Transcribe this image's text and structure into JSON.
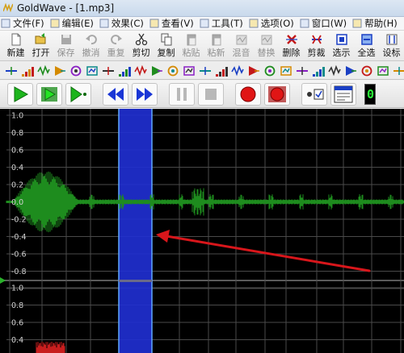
{
  "window": {
    "title": "GoldWave - [1.mp3]"
  },
  "menu": {
    "items": [
      {
        "label": "文件(F)",
        "icon": "file-doc-icon"
      },
      {
        "label": "编辑(E)",
        "icon": "edit-pencil-icon"
      },
      {
        "label": "效果(C)",
        "icon": "effects-icon"
      },
      {
        "label": "查看(V)",
        "icon": "view-icon"
      },
      {
        "label": "工具(T)",
        "icon": "tools-icon"
      },
      {
        "label": "选项(O)",
        "icon": "options-icon"
      },
      {
        "label": "窗口(W)",
        "icon": "window-icon"
      },
      {
        "label": "帮助(H)",
        "icon": "help-icon"
      }
    ]
  },
  "toolbar": {
    "buttons": [
      {
        "label": "新建",
        "icon": "new-file-icon",
        "enabled": true
      },
      {
        "label": "打开",
        "icon": "open-folder-icon",
        "enabled": true
      },
      {
        "label": "保存",
        "icon": "save-disk-icon",
        "enabled": false
      },
      {
        "label": "撤消",
        "icon": "undo-arrow-icon",
        "enabled": false
      },
      {
        "label": "重复",
        "icon": "redo-arrow-icon",
        "enabled": false
      },
      {
        "label": "剪切",
        "icon": "scissors-icon",
        "enabled": true
      },
      {
        "label": "复制",
        "icon": "copy-icon",
        "enabled": true
      },
      {
        "label": "粘贴",
        "icon": "paste-icon",
        "enabled": false
      },
      {
        "label": "粘新",
        "icon": "paste-new-icon",
        "enabled": false
      },
      {
        "label": "混音",
        "icon": "mix-icon",
        "enabled": false
      },
      {
        "label": "替换",
        "icon": "replace-icon",
        "enabled": false
      },
      {
        "label": "删除",
        "icon": "delete-icon",
        "enabled": true
      },
      {
        "label": "剪裁",
        "icon": "trim-icon",
        "enabled": true
      },
      {
        "label": "选示",
        "icon": "select-view-icon",
        "enabled": true
      },
      {
        "label": "全选",
        "icon": "select-all-icon",
        "enabled": true
      },
      {
        "label": "设标",
        "icon": "set-marker-icon",
        "enabled": true
      }
    ]
  },
  "effects_toolbar": {
    "icons": [
      "dc-offset-icon",
      "equalizer-icon",
      "doppler-icon",
      "echo-icon",
      "fade-in-icon",
      "fade-out-icon",
      "pan-icon",
      "invert-icon",
      "volume-icon",
      "pitch-icon",
      "noise-icon",
      "filter-icon",
      "spectrum-icon",
      "compressor-icon",
      "mechanize-icon",
      "reverse-icon",
      "offset-icon",
      "flanger-icon",
      "resample-icon",
      "shape-icon",
      "channel-icon",
      "matrix-icon",
      "grid-icon",
      "playback-rate-icon",
      "time-warp-icon",
      "noise-reduction-icon",
      "pop-click-icon",
      "lowpass-icon",
      "highpass-icon",
      "bandpass-icon",
      "bass-icon",
      "treble-icon"
    ]
  },
  "transport": {
    "buttons": [
      {
        "name": "play-button",
        "icon": "play-icon"
      },
      {
        "name": "play-selection-button",
        "icon": "play-selection-icon"
      },
      {
        "name": "play-cursor-button",
        "icon": "play-from-cursor-icon"
      },
      {
        "name": "rewind-button",
        "icon": "rewind-icon"
      },
      {
        "name": "fast-forward-button",
        "icon": "fast-forward-icon"
      },
      {
        "name": "pause-button",
        "icon": "pause-icon"
      },
      {
        "name": "stop-button",
        "icon": "stop-icon"
      },
      {
        "name": "record-button",
        "icon": "record-icon"
      },
      {
        "name": "record-selection-button",
        "icon": "record-selection-icon"
      },
      {
        "name": "options-toggle",
        "icon": "checkbox-toggle-icon"
      },
      {
        "name": "window-view-button",
        "icon": "window-view-icon"
      }
    ],
    "level_text": "0",
    "colors": {
      "play_green": "#1db51d",
      "rewind_blue": "#1a36d6",
      "record_red": "#e01515",
      "display_green": "#2bff3a"
    }
  },
  "waveform": {
    "top_channel_labels": [
      "1.0",
      "0.8",
      "0.6",
      "0.4",
      "0.2",
      "0.0",
      "-0.2",
      "-0.4",
      "-0.6",
      "-0.8"
    ],
    "bottom_channel_labels": [
      "1.0",
      "0.8",
      "0.6",
      "0.4"
    ],
    "colors": {
      "background": "#000000",
      "grid": "#4a4a4a",
      "selection": "#1f2fd0",
      "wave_left": "#1e8c1e",
      "wave_right": "#c81e1e",
      "annotation_arrow": "#d8161b"
    }
  }
}
